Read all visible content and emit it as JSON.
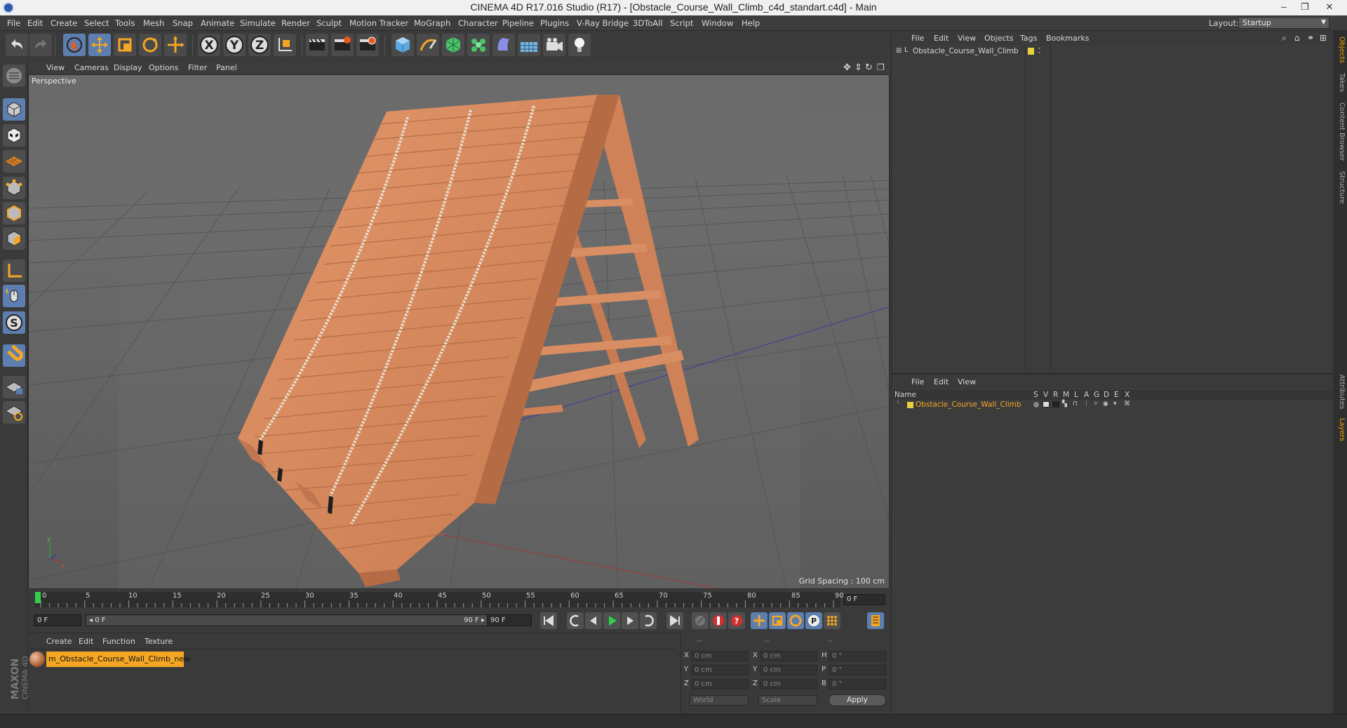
{
  "window": {
    "title": "CINEMA 4D R17.016 Studio (R17) - [Obstacle_Course_Wall_Climb_c4d_standart.c4d] - Main",
    "controls": [
      "–",
      "❐",
      "✕"
    ]
  },
  "menu": [
    "File",
    "Edit",
    "Create",
    "Select",
    "Tools",
    "Mesh",
    "Snap",
    "Animate",
    "Simulate",
    "Render",
    "Sculpt",
    "Motion Tracker",
    "MoGraph",
    "Character",
    "Pipeline",
    "Plugins",
    "V-Ray Bridge",
    "3DToAll",
    "Script",
    "Window",
    "Help"
  ],
  "layout": {
    "label": "Layout:",
    "value": "Startup"
  },
  "toolbar_icons": [
    "undo-icon",
    "redo-icon",
    "live-selection-icon",
    "move-icon",
    "scale-icon",
    "rotate-icon",
    "last-tool-icon",
    "x-axis-icon",
    "y-axis-icon",
    "z-axis-icon",
    "coordinate-system-icon",
    "render-view-icon",
    "render-picture-viewer-icon",
    "render-settings-icon",
    "cube-primitive-icon",
    "spline-pen-icon",
    "subdivision-surface-icon",
    "cloner-icon",
    "deformer-icon",
    "floor-icon",
    "camera-icon",
    "light-icon"
  ],
  "viewport": {
    "menu": [
      "View",
      "Cameras",
      "Display",
      "Options",
      "Filter",
      "Panel"
    ],
    "label": "Perspective",
    "grid_spacing": "Grid Spacing : 100 cm"
  },
  "timeline": {
    "ticks": [
      "0",
      "5",
      "10",
      "15",
      "20",
      "25",
      "30",
      "35",
      "40",
      "45",
      "50",
      "55",
      "60",
      "65",
      "70",
      "75",
      "80",
      "85",
      "90"
    ],
    "current_frame": "0 F",
    "start_field": "0 F",
    "range_start": "◂ 0 F",
    "range_end": "90 F ▸",
    "end_field": "90 F"
  },
  "material_panel": {
    "menu": [
      "Create",
      "Edit",
      "Function",
      "Texture"
    ],
    "material_name": "m_Obstacle_Course_Wall_Climb_new"
  },
  "coordinates": {
    "headers": [
      "--",
      "--",
      "--"
    ],
    "rows": [
      {
        "a": "X",
        "a_val": "0 cm",
        "b": "X",
        "b_val": "0 cm",
        "c": "H",
        "c_val": "0 °"
      },
      {
        "a": "Y",
        "a_val": "0 cm",
        "b": "Y",
        "b_val": "0 cm",
        "c": "P",
        "c_val": "0 °"
      },
      {
        "a": "Z",
        "a_val": "0 cm",
        "b": "Z",
        "b_val": "0 cm",
        "c": "B",
        "c_val": "0 °"
      }
    ],
    "mode_select": "World",
    "size_select": "Scale",
    "apply_label": "Apply"
  },
  "object_manager": {
    "menu": [
      "File",
      "Edit",
      "View",
      "Objects",
      "Tags",
      "Bookmarks"
    ],
    "object_name": "Obstacle_Course_Wall_Climb"
  },
  "layer_manager": {
    "menu": [
      "File",
      "Edit",
      "View"
    ],
    "columns": [
      "Name",
      "S",
      "V",
      "R",
      "M",
      "L",
      "A",
      "G",
      "D",
      "E",
      "X"
    ],
    "layer_name": "Obstacle_Course_Wall_Climb"
  },
  "side_tabs": [
    "Objects",
    "Takes",
    "Content Browser",
    "Structure",
    "Attributes",
    "Layers"
  ],
  "brand": {
    "line1": "MAXON",
    "line2": "CINEMA 4D"
  },
  "colors": {
    "accent_blue": "#5c7fb0",
    "selection_orange": "#f5a623",
    "layer_yellow": "#e6d23a",
    "wood": "#d98a5e"
  }
}
